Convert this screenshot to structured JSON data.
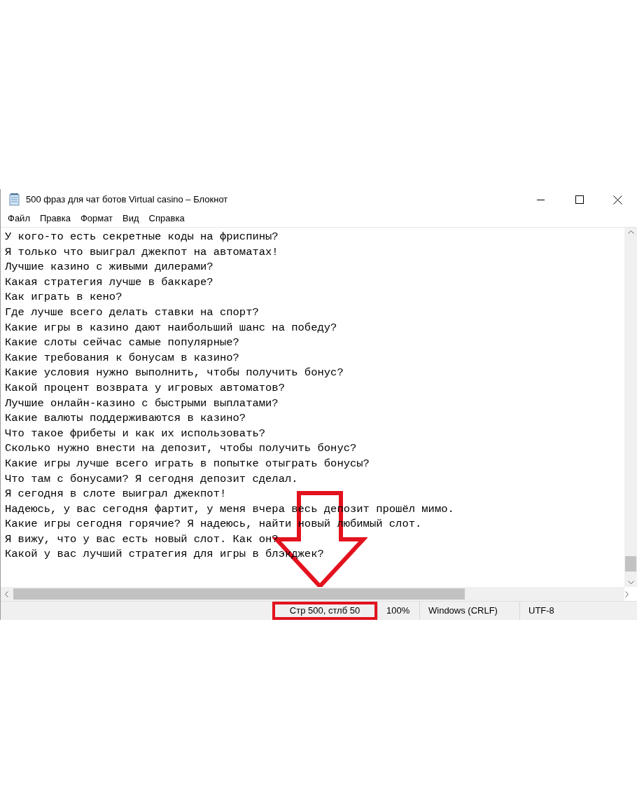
{
  "window": {
    "title": "500 фраз для чат ботов Virtual casino – Блокнот"
  },
  "menu": [
    "Файл",
    "Правка",
    "Формат",
    "Вид",
    "Справка"
  ],
  "lines": [
    "У кого-то есть секретные коды на фриспины?",
    "Я только что выиграл джекпот на автоматах!",
    "Лучшие казино с живыми дилерами?",
    "Какая стратегия лучше в баккаре?",
    "Как играть в кено?",
    "Где лучше всего делать ставки на спорт?",
    "Какие игры в казино дают наибольший шанс на победу?",
    "Какие слоты сейчас самые популярные?",
    "Какие требования к бонусам в казино?",
    "Какие условия нужно выполнить, чтобы получить бонус?",
    "Какой процент возврата у игровых автоматов?",
    "Лучшие онлайн-казино с быстрыми выплатами?",
    "Какие валюты поддерживаются в казино?",
    "Что такое фрибеты и как их использовать?",
    "Сколько нужно внести на депозит, чтобы получить бонус?",
    "Какие игры лучше всего играть в попытке отыграть бонусы?",
    "Что там с бонусами? Я сегодня депозит сделал.",
    "Я сегодня в слоте выиграл джекпот!",
    "Надеюсь, у вас сегодня фартит, у меня вчера весь депозит прошёл мимо.",
    "Какие игры сегодня горячие? Я надеюсь, найти новый любимый слот.",
    "Я вижу, что у вас есть новый слот. Как он?",
    "Какой у вас лучший стратегия для игры в блэкджек?"
  ],
  "status_bar": [
    {
      "text": "Стр 500, стлб 50",
      "highlighted": true
    },
    {
      "text": "100%",
      "highlighted": false
    },
    {
      "text": "Windows (CRLF)",
      "highlighted": false
    },
    {
      "text": "UTF-8",
      "highlighted": false
    }
  ]
}
